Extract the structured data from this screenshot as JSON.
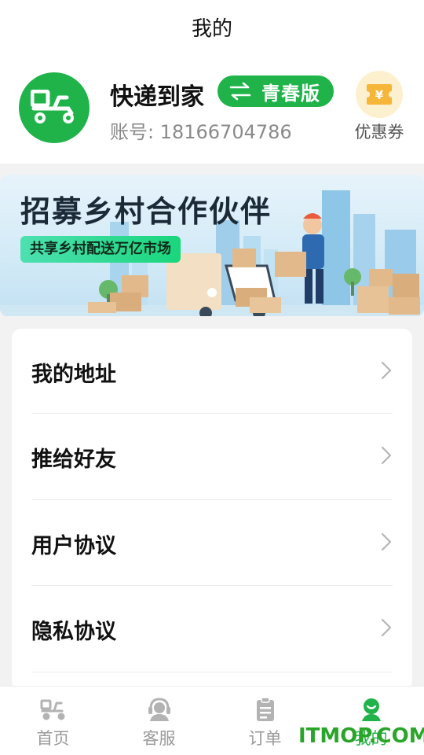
{
  "header": {
    "title": "我的"
  },
  "profile": {
    "app_name": "快递到家",
    "version_label": "青春版",
    "account": "账号: 18166704786",
    "logo_icon": "delivery-scooter-icon",
    "brand_color": "#1fb34a"
  },
  "coupon": {
    "label": "优惠券",
    "icon": "coupon-ticket-icon",
    "icon_glyph": "¥"
  },
  "banner": {
    "title": "招募乡村合作伙伴",
    "subtitle": "共享乡村配送万亿市场"
  },
  "menu": {
    "items": [
      {
        "label": "我的地址"
      },
      {
        "label": "推给好友"
      },
      {
        "label": "用户协议"
      },
      {
        "label": "隐私协议"
      }
    ]
  },
  "tabbar": {
    "tabs": [
      {
        "label": "首页",
        "icon": "scooter-icon",
        "active": false
      },
      {
        "label": "客服",
        "icon": "customer-service-icon",
        "active": false
      },
      {
        "label": "订单",
        "icon": "clipboard-icon",
        "active": false
      },
      {
        "label": "我的",
        "icon": "profile-icon",
        "active": true
      }
    ]
  },
  "watermark": {
    "text": "ITMOP.COM"
  }
}
